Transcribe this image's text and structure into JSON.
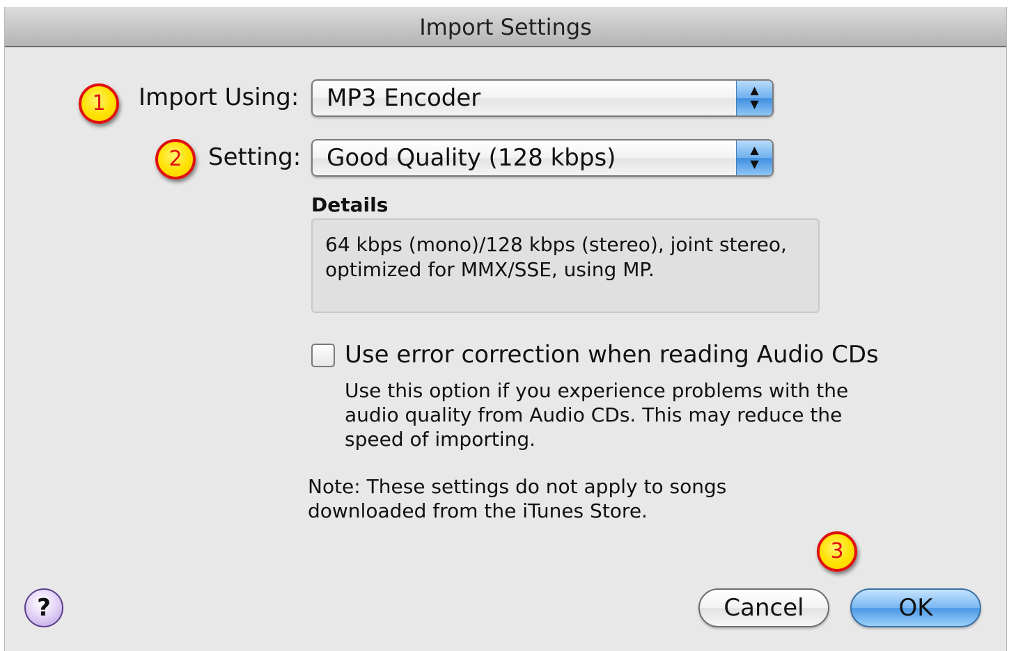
{
  "window": {
    "title": "Import Settings"
  },
  "markers": [
    "1",
    "2",
    "3"
  ],
  "import_using": {
    "label": "Import Using:",
    "value": "MP3 Encoder"
  },
  "setting": {
    "label": "Setting:",
    "value": "Good Quality (128 kbps)"
  },
  "popup_arrows": {
    "up": "▲",
    "down": "▼"
  },
  "details": {
    "label": "Details",
    "text": "64 kbps (mono)/128 kbps (stereo), joint stereo, optimized for MMX/SSE, using MP."
  },
  "error_correction": {
    "checked": false,
    "label": "Use error correction when reading Audio CDs",
    "help": "Use this option if you experience problems with the audio quality from Audio CDs. This may reduce the speed of importing."
  },
  "note": "Note: These settings do not apply to songs downloaded from the iTunes Store.",
  "buttons": {
    "help": "?",
    "cancel": "Cancel",
    "ok": "OK"
  },
  "colors": {
    "marker_fill": "#ffe100",
    "marker_border": "#e01010",
    "default_button": "#4a98e6"
  }
}
